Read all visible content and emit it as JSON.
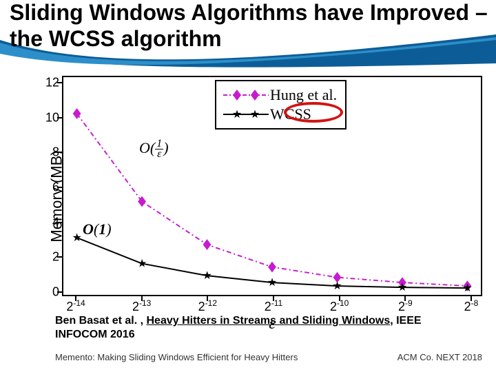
{
  "title": "Sliding Windows Algorithms have Improved – the WCSS algorithm",
  "chart_data": {
    "type": "line",
    "xlabel": "ε",
    "ylabel": "Memory (MB)",
    "ylim": [
      0,
      12
    ],
    "yticks": [
      0,
      2,
      4,
      6,
      8,
      10,
      12
    ],
    "xticks_exp": [
      -14,
      -13,
      -12,
      -11,
      -10,
      -9,
      -8
    ],
    "series": [
      {
        "name": "Hung et al.",
        "marker": "diamond",
        "color": "#c71bd0",
        "style": "dash-dot",
        "values": [
          10.2,
          5.1,
          2.6,
          1.3,
          0.7,
          0.4,
          0.2
        ]
      },
      {
        "name": "WCSS",
        "marker": "star",
        "color": "#000000",
        "style": "solid",
        "values": [
          3.0,
          1.5,
          0.8,
          0.4,
          0.2,
          0.12,
          0.08
        ]
      }
    ],
    "annotations": {
      "o_upper": "O(1/ε)",
      "o_lower": "O(1)"
    },
    "legend_labels": {
      "hung": "Hung et al.",
      "wcss": "WCSS"
    }
  },
  "citation_pre": "Ben Basat et al. , ",
  "citation_link": "Heavy Hitters in Streams and Sliding Windows",
  "citation_post": ", IEEE INFOCOM 2016",
  "footer_left": "Memento: Making Sliding Windows Efficient for Heavy Hitters",
  "footer_right": "ACM Co. NEXT 2018"
}
